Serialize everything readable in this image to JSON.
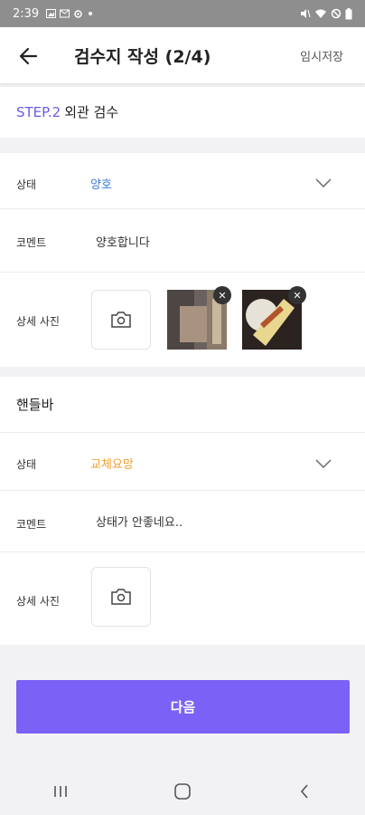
{
  "status_bar": {
    "time": "2:39",
    "left_icons": [
      "gallery-icon",
      "mail-icon",
      "settings-icon",
      "dot-icon"
    ],
    "right_icons": [
      "mute-icon",
      "wifi-icon",
      "dnd-icon",
      "battery-icon"
    ]
  },
  "header": {
    "title": "검수지 작성 (2/4)",
    "temp_save": "임시저장"
  },
  "step": {
    "number": "STEP.2",
    "title": "외관 검수"
  },
  "sections": [
    {
      "state_label": "상태",
      "state_value": "양호",
      "state_color": "#3a7be0",
      "comment_label": "코멘트",
      "comment_value": "양호합니다",
      "photo_label": "상세 사진",
      "photo_count": 2
    },
    {
      "item_title": "핸들바",
      "state_label": "상태",
      "state_value": "교체요망",
      "state_color": "#f0a030",
      "comment_label": "코멘트",
      "comment_value": "상태가 안좋네요..",
      "photo_label": "상세 사진",
      "photo_count": 0
    }
  ],
  "next_button": "다음",
  "colors": {
    "accent": "#7b61f5",
    "step_accent": "#6a5ce8"
  }
}
